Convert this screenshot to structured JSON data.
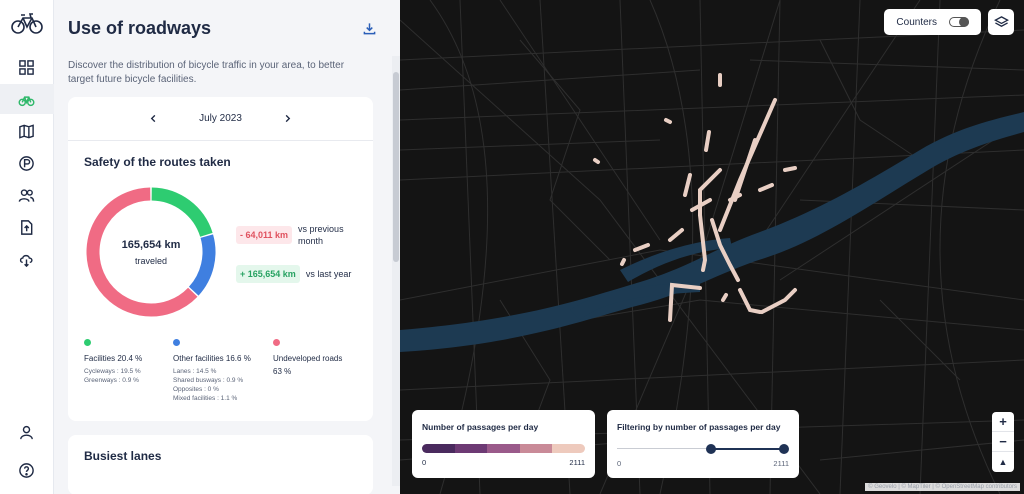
{
  "sidebar": {
    "logo_icon": "bicycle-icon",
    "items": [
      {
        "icon": "dashboard-grid-icon",
        "active": false
      },
      {
        "icon": "bicycle-icon",
        "active": true
      },
      {
        "icon": "map-icon",
        "active": false
      },
      {
        "icon": "parking-icon",
        "active": false
      },
      {
        "icon": "users-icon",
        "active": false
      },
      {
        "icon": "file-upload-icon",
        "active": false
      },
      {
        "icon": "cloud-download-icon",
        "active": false
      }
    ],
    "bottom_items": [
      {
        "icon": "user-icon"
      },
      {
        "icon": "help-icon"
      }
    ]
  },
  "panel": {
    "title": "Use of roadways",
    "description": "Discover the distribution of bicycle traffic in your area, to better target future bicycle facilities.",
    "month": "July 2023",
    "safety": {
      "title": "Safety of the routes taken",
      "total_value": "165,654 km",
      "total_unit": "traveled",
      "vs_previous_value": "- 64,011 km",
      "vs_previous_label": "vs previous month",
      "vs_last_year_value": "+ 165,654 km",
      "vs_last_year_label": "vs last year",
      "legend": [
        {
          "label": "Facilities 20.4 %",
          "color": "#2ecc71",
          "subs": [
            "Cycleways : 19.5 %",
            "Greenways : 0.9 %"
          ]
        },
        {
          "label": "Other facilities 16.6 %",
          "color": "#3f7fe0",
          "subs": [
            "Lanes : 14.5 %",
            "Shared busways : 0.9 %",
            "Opposites : 0 %",
            "Mixed facilities : 1.1 %"
          ]
        },
        {
          "label": "Undeveloped roads",
          "value": "63 %",
          "color": "#f06b84",
          "subs": []
        }
      ]
    },
    "busiest": {
      "title": "Busiest lanes"
    }
  },
  "chart_data": {
    "type": "pie",
    "categories": [
      "Facilities",
      "Other facilities",
      "Undeveloped roads"
    ],
    "values": [
      20.4,
      16.6,
      63
    ],
    "colors": [
      "#2ecc71",
      "#3f7fe0",
      "#f06b84"
    ],
    "title": "Safety of the routes taken"
  },
  "map": {
    "counters_label": "Counters",
    "counters_on": false,
    "layers_icon": "layers-icon",
    "passages_legend": {
      "title": "Number of passages per day",
      "min": "0",
      "max": "2111",
      "ramp": [
        "#4a2a5e",
        "#6d3a74",
        "#9a5a8a",
        "#c98a98",
        "#eecabd"
      ]
    },
    "filter_legend": {
      "title": "Filtering by number of passages per day",
      "min": "0",
      "max": "2111",
      "selected_min_fraction": 0.55,
      "selected_max_fraction": 1.0
    },
    "zoom_in": "+",
    "zoom_out": "−",
    "compass": "▲",
    "attribution": "© Geovelo | © MapTiler | © OpenStreetMap contributors"
  }
}
